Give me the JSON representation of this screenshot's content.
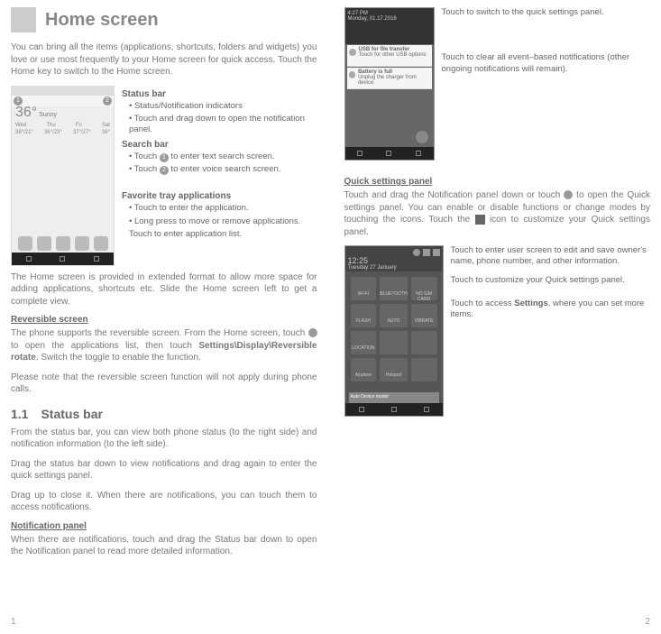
{
  "left": {
    "title": "Home screen",
    "intro": "You can bring all the items (applications, shortcuts, folders and widgets) you love or use most frequently to your Home screen for quick access. Touch the Home key to switch to the Home screen.",
    "statusbar_h": "Status bar",
    "statusbar_b1": "Status/Notification indicators",
    "statusbar_b2": "Touch and drag down to open the notification panel.",
    "searchbar_h": "Search bar",
    "searchbar_b1_pre": "Touch ",
    "searchbar_b1_post": " to enter text search screen.",
    "badge1": "1",
    "searchbar_b2_pre": "Touch ",
    "searchbar_b2_post": " to enter voice search screen.",
    "badge2": "2",
    "fav_h": "Favorite tray applications",
    "fav_b1": "Touch to enter the application.",
    "fav_b2": "Long press to move or remove applications.",
    "fav_b3": "Touch to enter application list.",
    "p_ext": "The Home screen is provided in extended format to allow more space for adding applications, shortcuts etc. Slide the Home screen left to get a complete view.",
    "rev_h": "Reversible screen",
    "rev_p1": "The phone supports the reversible screen. From the Home screen, touch   to open the applications list, then touch Settings\\Display\\Reversible rotate. Switch the toggle to enable the function.",
    "rev_p2": "Please note that the reversible screen function will not apply during phone calls.",
    "sec11": "1.1 Status bar",
    "p_sb1": "From the status bar, you can view both phone status (to the right side) and notification information (to the left side).",
    "p_sb2": "Drag the status bar down to view notifications and drag again to enter the quick settings panel.",
    "p_sb3": "Drag up to close it. When there are notifications, you can touch them to access notifications.",
    "np_h": "Notification panel",
    "np_p": "When there are notifications, touch and drag the Status bar down to open the Notification panel to read more detailed information.",
    "home_temp": "36°",
    "home_loc": "Sunny",
    "home_days": [
      "Wed",
      "Thu",
      "Fri",
      "Sat"
    ],
    "home_temps": [
      "38°/21°",
      "36°/23°",
      "37°/27°",
      "36°"
    ]
  },
  "right": {
    "a1": "Touch to switch to the quick settings panel.",
    "a2": "Touch to clear all event–based notifications (other ongoing notifications will remain).",
    "qs_h": "Quick settings panel",
    "qs_p_pre": "Touch and drag the Notification panel down or touch ",
    "qs_p_mid": " to open the Quick settings panel. You can enable or disable functions or change modes by touching the icons. Touch the ",
    "qs_p_post": " icon to customize your Quick settings panel.",
    "q1": "Touch to enter user screen to edit and save owner's name, phone number, and other information.",
    "q2": "Touch to customize your Quick settings panel.",
    "q3": "Touch to access Settings, where you can set more items.",
    "notif_time": "4:27 PM",
    "notif_date": "Monday, 01.17.2016",
    "notif1_t": "USB for file transfer",
    "notif1_s": "Touch for other USB options",
    "notif2_t": "Battery is full",
    "notif2_s": "Unplug the charger from device",
    "qs_time": "12:25",
    "qs_date": "Tuesday 27 January",
    "tiles": [
      "WI-FI",
      "BLUETOOTH",
      "NO SIM CARD",
      "FLASH",
      "AUTO",
      "VIBRATE",
      "LOCATION",
      "",
      "",
      "Airplane",
      "Hotspot",
      ""
    ],
    "qs_bot": "Auto   Device model"
  },
  "page_left": "1",
  "page_right": "2"
}
